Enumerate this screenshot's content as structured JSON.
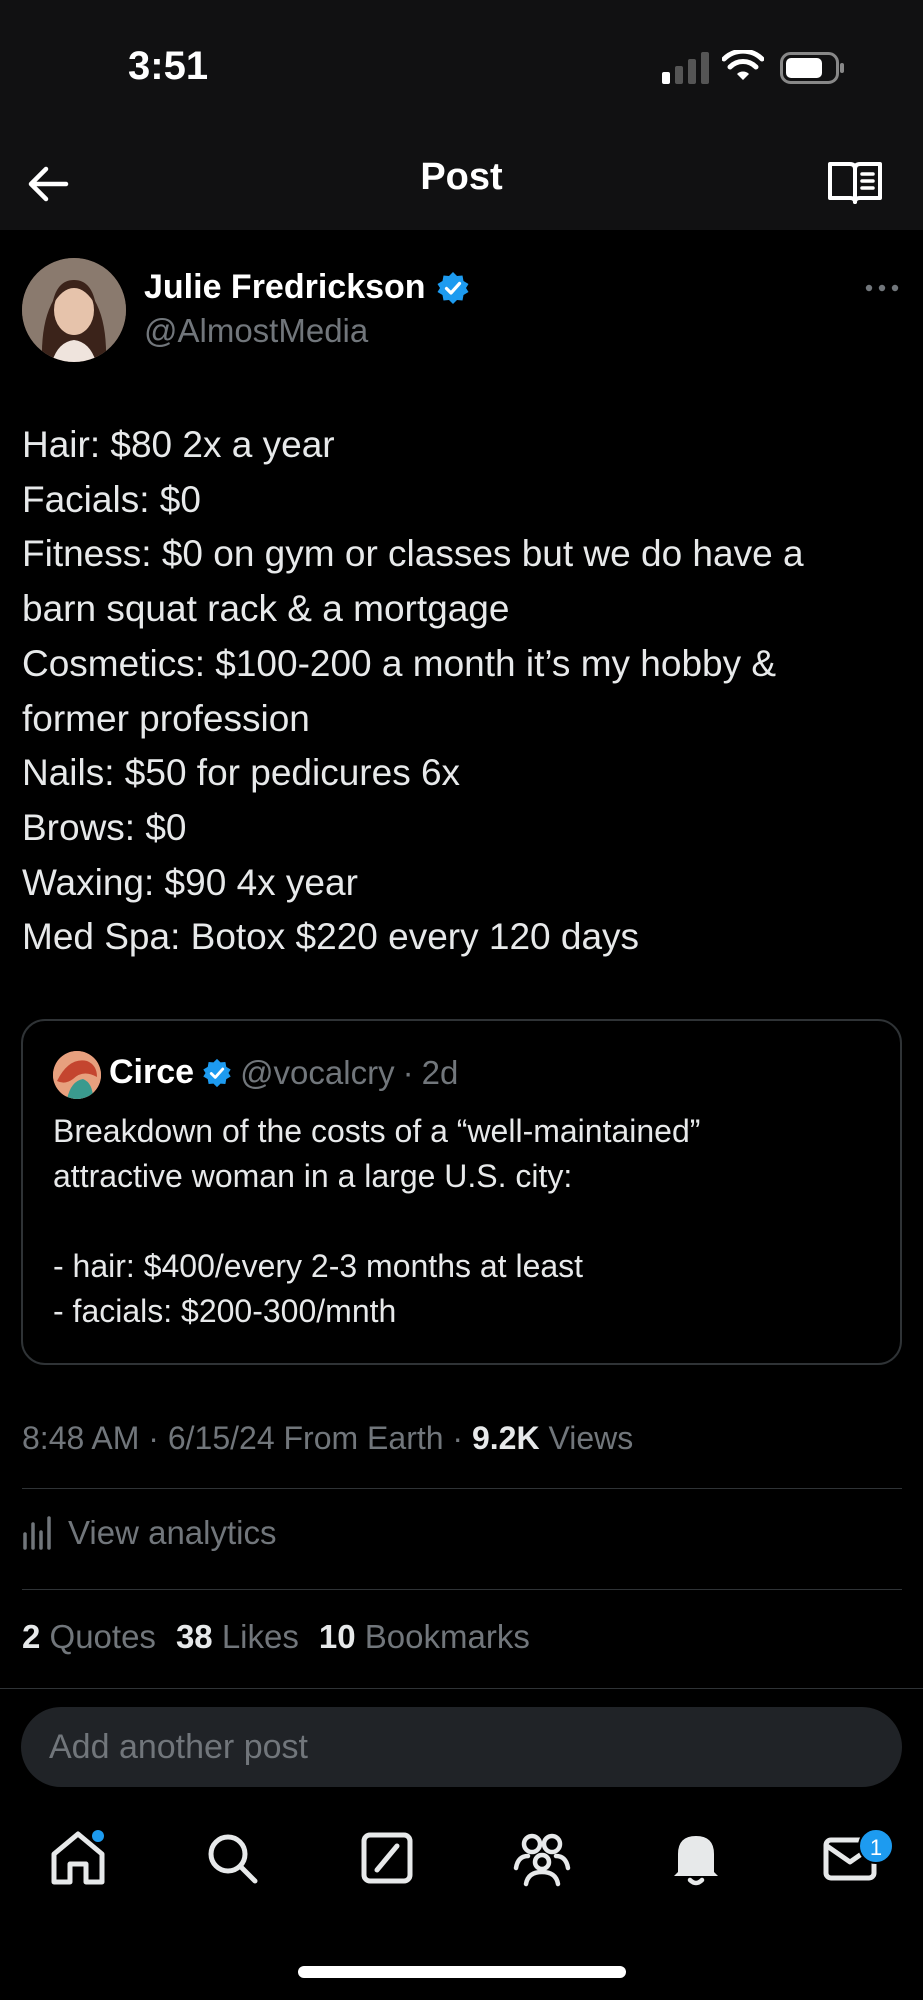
{
  "status_bar": {
    "time": "3:51"
  },
  "nav": {
    "title": "Post"
  },
  "author": {
    "name": "Julie Fredrickson",
    "handle": "@AlmostMedia"
  },
  "post": {
    "lines": [
      "Hair: $80 2x a year",
      "Facials: $0",
      "Fitness: $0 on gym or classes but we do have a",
      "barn squat rack & a mortgage",
      "Cosmetics: $100-200 a month it’s my hobby &",
      "former profession",
      "Nails: $50 for pedicures 6x",
      "Brows: $0",
      "Waxing: $90 4x year",
      "Med Spa: Botox $220 every 120 days"
    ]
  },
  "quote": {
    "name": "Circe",
    "handle": "@vocalcry",
    "separator": "·",
    "time": "2d",
    "lines": [
      "Breakdown of the costs of a “well-maintained”",
      "attractive woman in a large U.S. city:",
      "",
      "- hair: $400/every 2-3 months at least",
      "- facials: $200-300/mnth"
    ]
  },
  "meta": {
    "time": "8:48 AM",
    "sep1": " · ",
    "date": "6/15/24",
    "source": " From Earth",
    "sep2": " · ",
    "views_count": "9.2K",
    "views_label": " Views"
  },
  "analytics": {
    "label": "View analytics"
  },
  "stats": [
    {
      "count": "2",
      "label": "Quotes"
    },
    {
      "count": "38",
      "label": "Likes"
    },
    {
      "count": "10",
      "label": "Bookmarks"
    }
  ],
  "reply": {
    "placeholder": "Add another post"
  },
  "tabs": {
    "items": [
      "home-icon",
      "search-icon",
      "grok-icon",
      "communities-icon",
      "notifications-icon",
      "messages-icon"
    ],
    "messages_badge": "1"
  },
  "colors": {
    "accent": "#1d9bf0",
    "background": "#000000",
    "muted": "#71767b"
  }
}
